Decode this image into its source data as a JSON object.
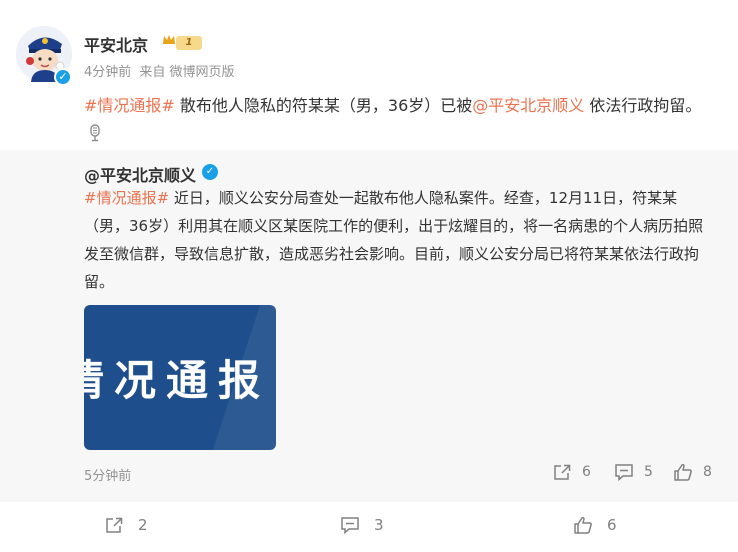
{
  "post": {
    "author": "平安北京",
    "level": "1",
    "time": "4分钟前",
    "source_prefix": "来自",
    "source": "微博网页版",
    "tag": "#情况通报#",
    "text_before": " 散布他人隐私的符某某（男，36岁）已被",
    "mention": "@平安北京顺义",
    "text_after": " 依法行政拘留。"
  },
  "repost": {
    "author": "@平安北京顺义",
    "tag": "#情况通报#",
    "text": " 近日，顺义公安分局查处一起散布他人隐私案件。经查，12月11日，符某某（男，36岁）利用其在顺义区某医院工作的便利，出于炫耀目的，将一名病患的个人病历拍照发至微信群，导致信息扩散，造成恶劣社会影响。目前，顺义公安分局已将符某某依法行政拘留。",
    "image_text": "情况通报",
    "time": "5分钟前",
    "shares": "6",
    "comments": "5",
    "likes": "8"
  },
  "actions": {
    "shares": "2",
    "comments": "3",
    "likes": "6"
  },
  "colors": {
    "accent": "#eb7350",
    "verified": "#1aa0e6",
    "repost_bg": "#f7f7f7",
    "image_bg": "#1f4e8c"
  },
  "icons": {
    "share": "share-icon",
    "comment": "comment-icon",
    "like": "like-icon",
    "voice": "microphone-icon",
    "verified": "verified-icon",
    "crown": "crown-icon"
  }
}
